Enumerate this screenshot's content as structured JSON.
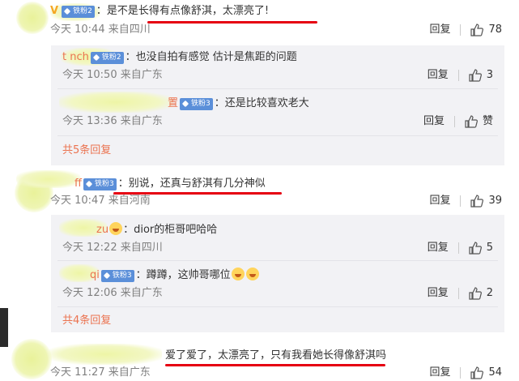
{
  "comments": [
    {
      "text": "是不是长得有点像舒淇，太漂亮了!",
      "badge": "铁粉2",
      "time": "今天 10:44",
      "location": "来自四川",
      "reply": "回复",
      "likes": "78",
      "replies": [
        {
          "name_visible": "t   nch",
          "badge": "铁粉2",
          "text": "也没自拍有感觉 估计是焦距的问题",
          "time": "今天 10:50",
          "location": "来自广东",
          "reply": "回复",
          "likes": "3"
        },
        {
          "name_visible": "置",
          "badge": "铁粉3",
          "text": "还是比较喜欢老大",
          "time": "今天 13:36",
          "location": "来自广东",
          "reply": "回复",
          "likes": "赞"
        }
      ],
      "more": "共5条回复"
    },
    {
      "name_visible": "ff",
      "badge": "铁粉3",
      "text": "别说，还真与舒淇有几分神似",
      "time": "今天 10:47",
      "location": "来自河南",
      "reply": "回复",
      "likes": "39",
      "replies": [
        {
          "name_visible": "zu",
          "text": "dior的柜哥吧哈哈",
          "time": "今天 12:22",
          "location": "来自四川",
          "reply": "回复",
          "likes": "5"
        },
        {
          "name_visible": "qi",
          "badge": "铁粉3",
          "text": "蹲蹲，这帅哥哪位",
          "time": "今天 12:06",
          "location": "来自广东",
          "reply": "回复",
          "likes": "2"
        }
      ],
      "more": "共4条回复"
    },
    {
      "text": "爱了爱了，太漂亮了，只有我看她长得像舒淇吗",
      "time": "今天 11:27",
      "location": "来自广东",
      "reply": "回复",
      "likes": "54"
    }
  ],
  "colors": {
    "accent": "#eb7350",
    "badge": "#5b8fd9",
    "underline": "#e60012",
    "subbox": "#f2f2f5"
  },
  "icons": {
    "like": "thumbs-up-icon",
    "badge": "fan-badge-icon"
  }
}
